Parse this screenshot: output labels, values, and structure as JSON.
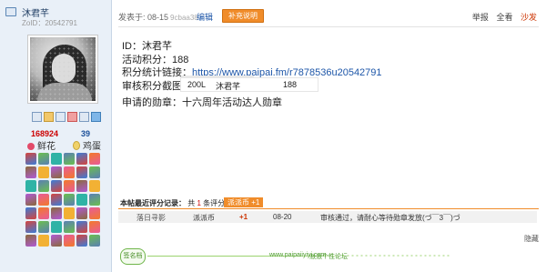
{
  "user": {
    "name": "沐君芊",
    "id_line": "ZoID：20542791",
    "stat_flowers": "168924",
    "stat_eggs": "39",
    "flower_label": "鲜花",
    "egg_label": "鸡蛋"
  },
  "post": {
    "posted_prefix": "发表于",
    "posted_time": ": 08-15",
    "posted_by": "9cbaa38",
    "edit_label": "编辑",
    "supplement_label": "补充说明",
    "report_label": "举报",
    "view_all_label": "全看",
    "floor_label": "沙发"
  },
  "content": {
    "id_line": "ID：沐君芊",
    "points_line": "活动积分：188",
    "link_prefix": "积分统计链接：",
    "link_url": "https://www.paipai.fm/r7878536u20542791",
    "screenshot_label": "审核积分截图：",
    "screenshot_cells": [
      "200L",
      "沐君芊",
      "188"
    ],
    "medal_line": "申请的勋章：十六周年活动达人勋章"
  },
  "rating": {
    "title": "本帖最近评分记录：",
    "count_prefix": "共",
    "count": "1",
    "count_suffix": "条评分",
    "badge": "派派币 +1",
    "row": {
      "user": "落日寻影",
      "currency": "派派币",
      "amount": "+1",
      "date": "08-20",
      "reason": "审核通过，请耐心等待勋章发放(づ￣3￣)づ"
    }
  },
  "footer": {
    "hide_label": "隐藏",
    "signature_label": "签名档",
    "signature_url": "www.paipaiiyiyi.com",
    "signature_text": "派派个性论坛"
  },
  "colors": {
    "accent": "#f08c2a",
    "link": "#1d56a8",
    "flower_red": "#cc0000",
    "sidebar_bg": "#e9f0f8"
  }
}
